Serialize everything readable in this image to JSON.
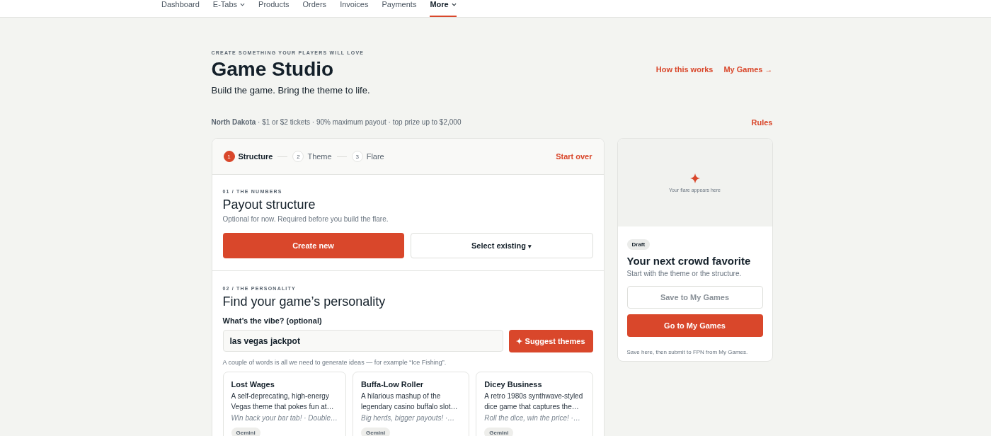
{
  "nav": [
    {
      "label": "Dashboard",
      "has_menu": false,
      "selected": false
    },
    {
      "label": "E-Tabs",
      "has_menu": true,
      "selected": false
    },
    {
      "label": "Products",
      "has_menu": false,
      "selected": false
    },
    {
      "label": "Orders",
      "has_menu": false,
      "selected": false
    },
    {
      "label": "Invoices",
      "has_menu": false,
      "selected": false
    },
    {
      "label": "Payments",
      "has_menu": false,
      "selected": false
    },
    {
      "label": "More",
      "has_menu": true,
      "selected": true
    }
  ],
  "header": {
    "eyebrow": "CREATE SOMETHING YOUR PLAYERS WILL LOVE",
    "title": "Game Studio",
    "subtitle": "Build the game. Bring the theme to life.",
    "links": [
      "How this works",
      "My Games →"
    ]
  },
  "info": {
    "text": "**North Dakota** · $1 or $2 tickets · 90% maximum payout · top prize up to $2,000",
    "link": "Rules"
  },
  "steps": [
    {
      "number": "1",
      "label": "Structure",
      "selected": true
    },
    {
      "number": "2",
      "label": "Theme",
      "selected": false
    },
    {
      "number": "3",
      "label": "Flare",
      "selected": false
    }
  ],
  "start_over": "Start over",
  "numbers": {
    "eyebrow": "01 / THE NUMBERS",
    "title": "Payout structure",
    "note": "Optional for now. Required before you build the flare.",
    "create": "Create new",
    "select": "Select existing",
    "select_caret": "▾"
  },
  "personality": {
    "eyebrow": "02 / THE PERSONALITY",
    "title": "Find your game’s personality",
    "label": "What’s the vibe? (optional)",
    "value": "las vegas jackpot",
    "button": "✦ Suggest themes",
    "hint": "A couple of words is all we need to generate ideas — for example “Ice Fishing”."
  },
  "themes": [
    {
      "name": "Lost Wages",
      "description": "A self-deprecating, high-energy Vegas theme that pokes fun at…",
      "tagline": "Win back your bar tab! · Double…",
      "tag": "Gemini"
    },
    {
      "name": "Buffa-Low Roller",
      "description": "A hilarious mashup of the legendary casino buffalo slot…",
      "tagline": "Big herds, bigger payouts! ·…",
      "tag": "Gemini"
    },
    {
      "name": "Dicey Business",
      "description": "A retro 1980s synthwave-styled dice game that captures the…",
      "tagline": "Roll the dice, win the price! ·…",
      "tag": "Gemini"
    }
  ],
  "preview": {
    "caption": "Your flare appears here",
    "badge": "Draft",
    "title": "Your next crowd favorite",
    "subtitle": "Start with the theme or the structure.",
    "save": {
      "label": "Save to My Games",
      "disabled": true
    },
    "go": "Go to My Games",
    "footnote": "Save here, then submit to FPN from My Games."
  }
}
